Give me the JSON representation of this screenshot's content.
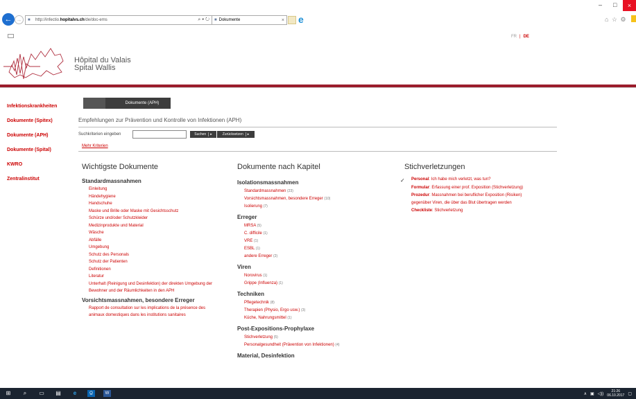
{
  "browser": {
    "url_prefix": "http://infectio.",
    "url_domain": "hopitalvs.ch",
    "url_path": "/de/doc-ems",
    "address_tools": "⌕ ▾ ↻",
    "tab_title": "Dokumente",
    "tab_close": "×",
    "back_icon": "←",
    "forward_icon": "→",
    "win_min": "–",
    "win_max": "□",
    "win_close": "×",
    "chrome_icons": "⌂ ☆ ⚙",
    "ie_glyph": "e"
  },
  "header": {
    "lang_fr": "FR",
    "lang_sep": "|",
    "lang_de": "DE",
    "logo_line1": "Hôpital du Valais",
    "logo_line2": "Spital Wallis",
    "accent_color": "#9b1c2b"
  },
  "sidebar": {
    "items": [
      {
        "label": "Infektionskrankheiten"
      },
      {
        "label": "Dokumente (Spitex)"
      },
      {
        "label": "Dokumente (APH)"
      },
      {
        "label": "Dokumente (Spital)"
      },
      {
        "label": "KWRO"
      },
      {
        "label": "Zentralinstitut"
      }
    ]
  },
  "main": {
    "tab_label": "Dokumente (APH)",
    "subtitle": "Empfehlungen zur Prävention und Kontrolle von Infektionen (APH)",
    "search_label": "Suchkriterien eingeben",
    "search_value": "",
    "search_button": "Suchen",
    "reset_button": "Zurücksetzen",
    "button_arrow": "▸",
    "more_criteria": "Mehr Kriterien"
  },
  "col1": {
    "title": "Wichtigste Dokumente",
    "sections": [
      {
        "heading": "Standardmassnahmen",
        "items": [
          "Einleitung",
          "Händehygiene",
          "Handschuhe",
          "Maske und Brille oder Maske mit Gesichtsschutz",
          "Schürze und/oder Schutzkleider",
          "Medizinprodukte und Material",
          "Wäsche",
          "Abfälle",
          "Umgebung",
          "Schutz des Personals",
          "Schutz der Patienten",
          "Definitionen",
          "Literatur",
          "Unterhalt (Reinigung und Desinfektion) der direkten Umgebung der Bewohner und der Räumlichkeiten in den APH"
        ]
      },
      {
        "heading": "Vorsichtsmassnahmen, besondere Erreger",
        "items": [
          "Rapport de consultation sur les implications de la présence des animaux domestiques dans les institutions sanitaires"
        ]
      }
    ]
  },
  "col2": {
    "title": "Dokumente nach Kapitel",
    "sections": [
      {
        "heading": "Isolationsmassnahmen",
        "items": [
          {
            "label": "Standardmassnahmen",
            "count": "(23)"
          },
          {
            "label": "Vorsichtsmassnahmen, besondere Erreger",
            "count": "(10)"
          },
          {
            "label": "Isolierung",
            "count": "(7)"
          }
        ]
      },
      {
        "heading": "Erreger",
        "items": [
          {
            "label": "MRSA",
            "count": "(5)"
          },
          {
            "label": "C. difficile",
            "count": "(1)"
          },
          {
            "label": "VRE",
            "count": "(1)"
          },
          {
            "label": "ESBL",
            "count": "(1)"
          },
          {
            "label": "andere Erreger",
            "count": "(2)"
          }
        ]
      },
      {
        "heading": "Viren",
        "items": [
          {
            "label": "Norovirus",
            "count": "(1)"
          },
          {
            "label": "Grippe (Influenza)",
            "count": "(1)"
          }
        ]
      },
      {
        "heading": "Techniken",
        "items": [
          {
            "label": "Pflegetechnik",
            "count": "(8)"
          },
          {
            "label": "Therapien (Physio, Ergo usw.)",
            "count": "(3)"
          },
          {
            "label": "Küche, Nahrungsmittel",
            "count": "(1)"
          }
        ]
      },
      {
        "heading": "Post-Expositions-Prophylaxe",
        "items": [
          {
            "label": "Stichverletzung",
            "count": "(5)"
          },
          {
            "label": "Personalgesundheit (Prävention von Infektionen)",
            "count": "(4)"
          }
        ]
      },
      {
        "heading": "Material, Desinfektion",
        "items": []
      }
    ]
  },
  "col3": {
    "title": "Stichverletzungen",
    "items": [
      {
        "bold": "Personal",
        "text": ": Ich habe mich verletzt, was tun?"
      },
      {
        "bold": "Formular",
        "text": ": Erfassung einer prof. Exposition (Stichverletzung)"
      },
      {
        "bold": "Prozedur",
        "text": ": Massnahmen bei beruflicher Exposition (Risiken) gegenüber Viren, die über das Blut übertragen werden"
      },
      {
        "bold": "Checkliste",
        "text": ": Stichverletzung"
      }
    ]
  },
  "taskbar": {
    "start": "⊞",
    "search": "⌕",
    "taskview": "▭",
    "explorer": "▤",
    "ie": "e",
    "mail": "O̲",
    "word": "W",
    "tray_up": "∧",
    "tray_net": "▣",
    "tray_vol": "◁))",
    "time": "21:26",
    "date": "06.10.2017",
    "notify": "▢"
  }
}
